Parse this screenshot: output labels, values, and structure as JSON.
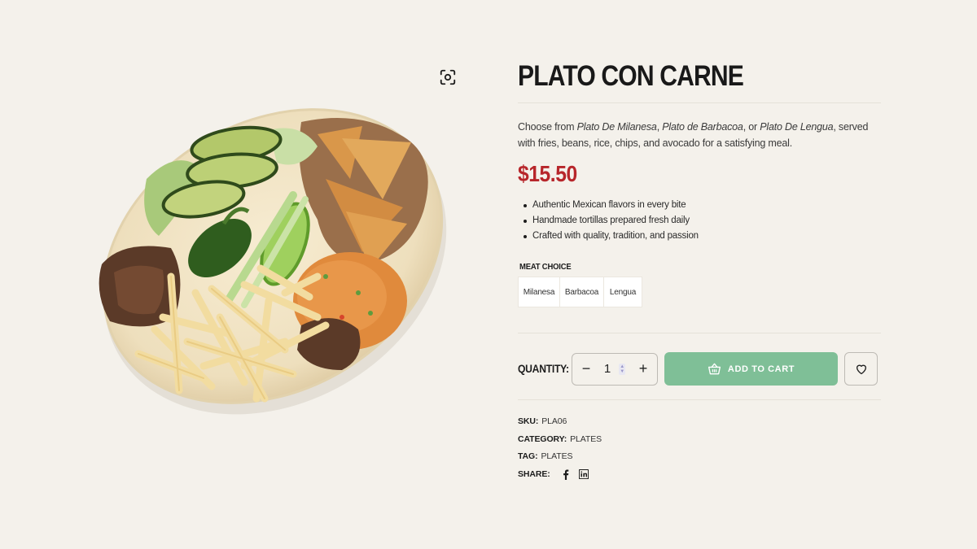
{
  "product": {
    "title": "PLATO CON CARNE",
    "description": {
      "prefix": "Choose from ",
      "option1": "Plato De Milanesa",
      "sep1": ", ",
      "option2": "Plato de Barbacoa",
      "sep2": ", or ",
      "option3": "Plato De Lengua",
      "suffix": ", served with fries, beans, rice, chips, and avocado for a satisfying meal."
    },
    "price": "$15.50",
    "features": [
      "Authentic Mexican flavors in every bite",
      "Handmade tortillas prepared fresh daily",
      "Crafted with quality, tradition, and passion"
    ]
  },
  "variations": {
    "label": "MEAT CHOICE",
    "options": [
      "Milanesa",
      "Barbacoa",
      "Lengua"
    ]
  },
  "cart": {
    "quantity_label": "QUANTITY:",
    "quantity_value": "1",
    "minus_symbol": "−",
    "plus_symbol": "+",
    "add_to_cart_label": "ADD TO CART",
    "add_to_cart_color": "#7fbf97"
  },
  "meta": {
    "sku_label": "SKU:",
    "sku_value": "PLA06",
    "category_label": "CATEGORY:",
    "category_value": "PLATES",
    "tag_label": "TAG:",
    "tag_value": "PLATES",
    "share_label": "SHARE:"
  },
  "icons": {
    "zoom": "zoom-icon",
    "basket": "basket-icon",
    "heart": "heart-icon",
    "facebook": "facebook-icon",
    "linkedin": "linkedin-icon"
  },
  "colors": {
    "background": "#f4f1eb",
    "price": "#b7262b",
    "button": "#7fbf97"
  }
}
